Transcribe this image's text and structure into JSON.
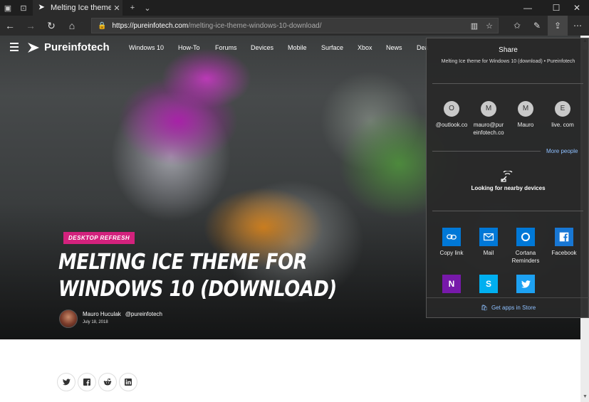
{
  "tab": {
    "title": "Melting Ice theme for W"
  },
  "address": {
    "host": "https://pureinfotech.com",
    "path": "/melting-ice-theme-windows-10-download/"
  },
  "site": {
    "logo": "Pureinfotech",
    "nav": [
      "Windows 10",
      "How-To",
      "Forums",
      "Devices",
      "Mobile",
      "Surface",
      "Xbox",
      "News",
      "Dea"
    ]
  },
  "article": {
    "badge": "DESKTOP REFRESH",
    "headline": "MELTING ICE THEME FOR WINDOWS 10 (DOWNLOAD)",
    "author": "Mauro Huculak",
    "handle": "@pureinfotech",
    "date": "July 18, 2018"
  },
  "share_panel": {
    "title": "Share",
    "subtitle": "Melting Ice theme for Windows 10 (download) • Pureinfotech",
    "people": [
      {
        "initial": "O",
        "name": "@outlook.co"
      },
      {
        "initial": "M",
        "name": "mauro@pur einfotech.co"
      },
      {
        "initial": "M",
        "name": "Mauro"
      },
      {
        "initial": "E",
        "name": "live. com"
      }
    ],
    "more_people": "More people",
    "nearby": "Looking for nearby devices",
    "apps": [
      {
        "label": "Copy link",
        "icon": "link-icon",
        "color": "#0078d7"
      },
      {
        "label": "Mail",
        "icon": "mail-icon",
        "color": "#0078d7"
      },
      {
        "label": "Cortana Reminders",
        "icon": "cortana-icon",
        "color": "#0078d7"
      },
      {
        "label": "Facebook",
        "icon": "facebook-icon",
        "color": "#1877d4"
      },
      {
        "label": "",
        "icon": "onenote-icon",
        "color": "#7719aa"
      },
      {
        "label": "",
        "icon": "skype-icon",
        "color": "#00aff0"
      },
      {
        "label": "",
        "icon": "twitter-icon",
        "color": "#1da1f2"
      }
    ],
    "store_link": "Get apps in Store"
  },
  "social_icons": [
    "twitter-icon",
    "facebook-icon",
    "reddit-icon",
    "linkedin-icon"
  ]
}
